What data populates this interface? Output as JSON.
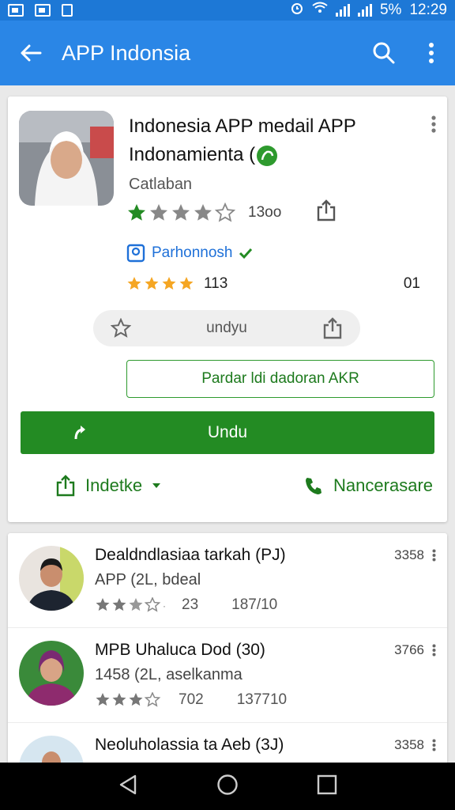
{
  "status_bar": {
    "time": "12:29",
    "battery": "5%"
  },
  "header": {
    "title": "APP Indonsia"
  },
  "app": {
    "name_line1": "Indonesia APP medail APP",
    "name_line2": "Indonamienta (",
    "developer": "Catlaban",
    "rating_count": "13oo",
    "verified_label": "Parhonnosh",
    "rating2_count": "113",
    "rating2_extra": "01",
    "pill_label": "undyu",
    "outline_button": "Pardar ldi dadoran AKR",
    "install_button": "Undu",
    "action_left": "Indetke",
    "action_right": "Nancerasare"
  },
  "list": [
    {
      "title": "Dealdndlasiaa tarkah (PJ)",
      "subtitle": "APP (2L, bdeal",
      "rating_text": "23",
      "downloads": "187/10",
      "size": "3358"
    },
    {
      "title": "MPB Uhaluca Dod (30)",
      "subtitle": "1458 (2L, aselkanma",
      "rating_text": "702",
      "downloads": "137710",
      "size": "3766"
    },
    {
      "title": "Neoluholassia ta Aeb (3J)",
      "subtitle": "",
      "rating_text": "",
      "downloads": "",
      "size": "3358"
    }
  ],
  "colors": {
    "primary": "#2a86e6",
    "green": "#238b23",
    "star": "#f5a623"
  }
}
